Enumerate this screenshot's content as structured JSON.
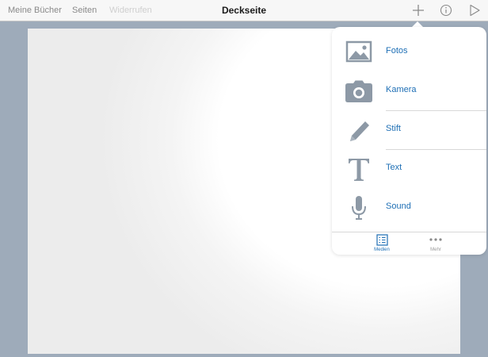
{
  "toolbar": {
    "my_books": "Meine Bücher",
    "pages": "Seiten",
    "undo": "Widerrufen",
    "title": "Deckseite",
    "add_icon": "plus-icon",
    "info_icon": "info-icon",
    "play_icon": "play-icon"
  },
  "menu": {
    "items": [
      {
        "label": "Fotos",
        "icon": "photos-icon"
      },
      {
        "label": "Kamera",
        "icon": "camera-icon"
      },
      {
        "label": "Stift",
        "icon": "pencil-icon"
      },
      {
        "label": "Text",
        "icon": "text-icon"
      },
      {
        "label": "Sound",
        "icon": "microphone-icon"
      }
    ],
    "tabs": [
      {
        "label": "Medien",
        "icon": "list-icon",
        "active": true
      },
      {
        "label": "Mehr",
        "icon": "more-icon",
        "active": false
      }
    ]
  },
  "colors": {
    "accent": "#1e6fb5",
    "icon_gray": "#8d99a6",
    "background": "#9eabba"
  }
}
